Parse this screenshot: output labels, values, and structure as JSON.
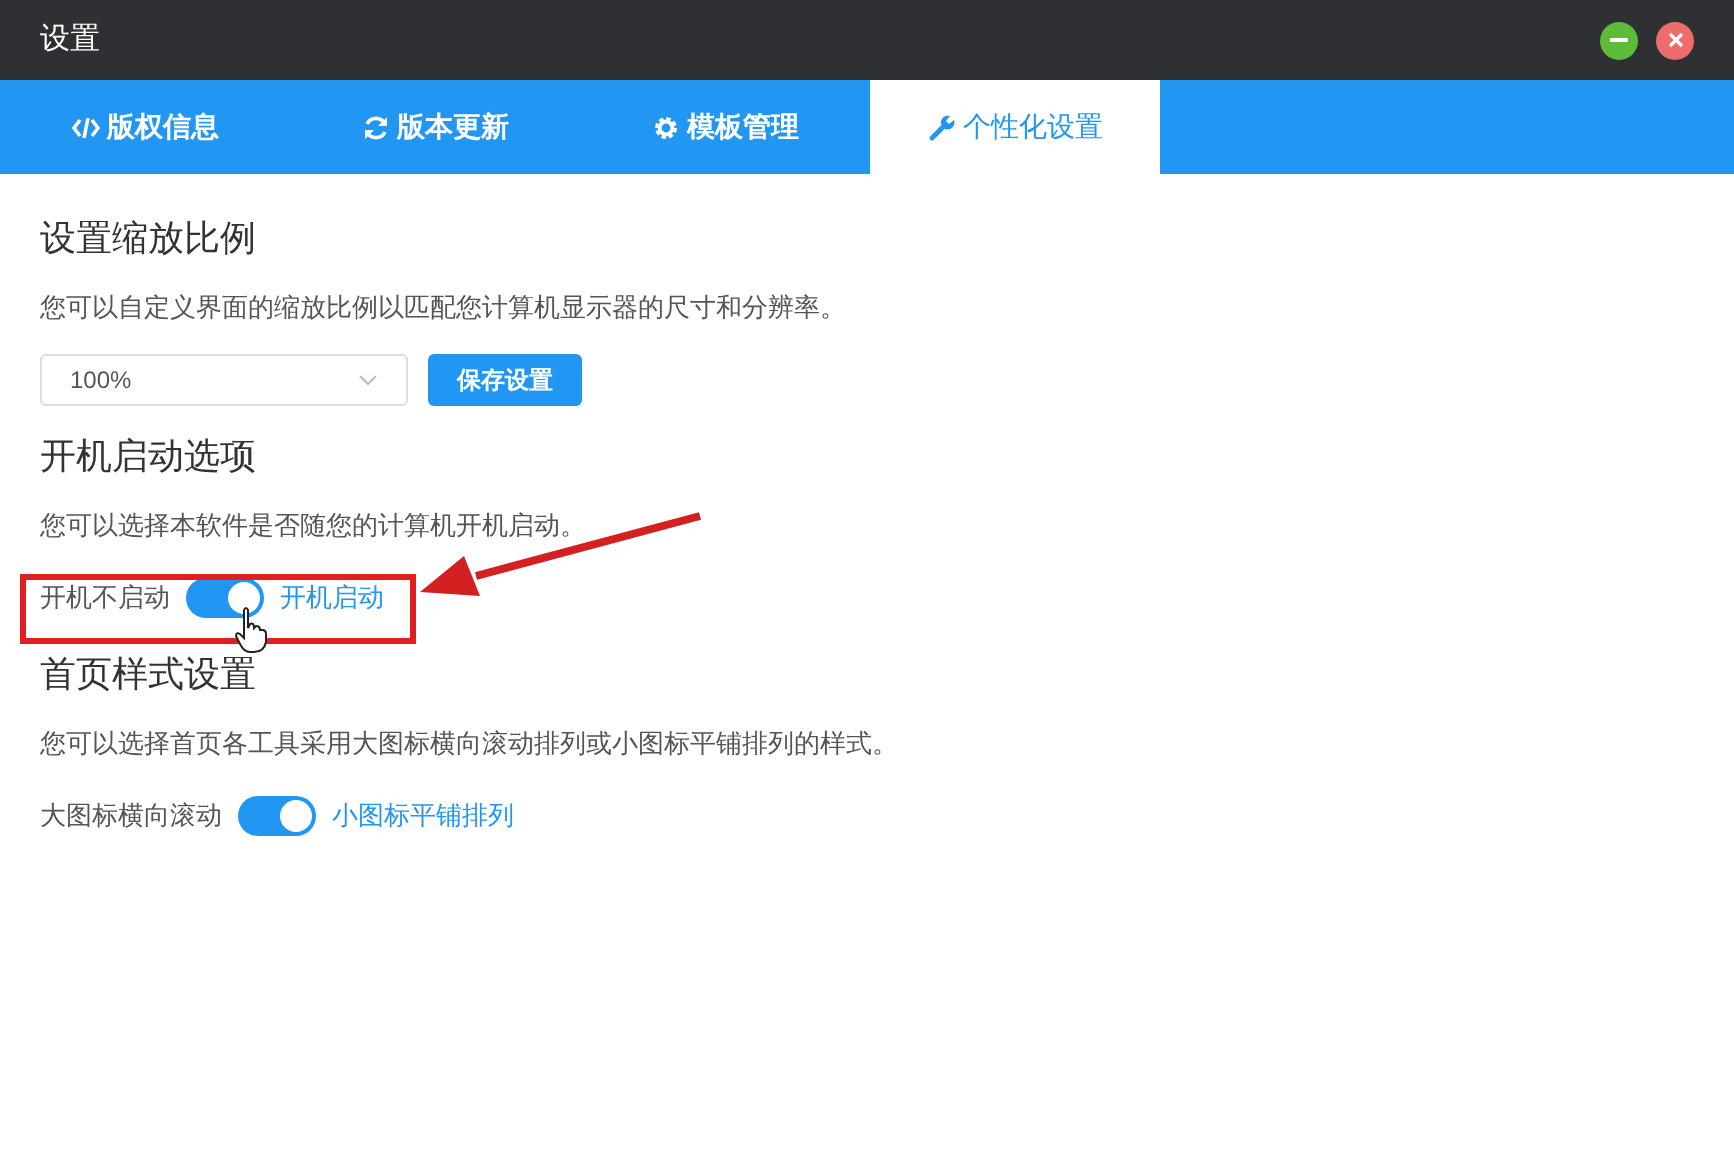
{
  "window": {
    "title": "设置"
  },
  "tabs": [
    {
      "label": "版权信息",
      "selected": false
    },
    {
      "label": "版本更新",
      "selected": false
    },
    {
      "label": "模板管理",
      "selected": false
    },
    {
      "label": "个性化设置",
      "selected": true
    }
  ],
  "sections": [
    {
      "title": "设置缩放比例",
      "description": "您可以自定义界面的缩放比例以匹配您计算机显示器的尺寸和分辨率。",
      "kind": "scale",
      "select_value": "100%",
      "button": "保存设置"
    },
    {
      "title": "开机启动选项",
      "description": "您可以选择本软件是否随您的计算机开机启动。",
      "kind": "toggle",
      "off_label": "开机不启动",
      "on_label": "开机启动",
      "on": true
    },
    {
      "title": "首页样式设置",
      "description": "您可以选择首页各工具采用大图标横向滚动排列或小图标平铺排列的样式。",
      "kind": "toggle",
      "off_label": "大图标横向滚动",
      "on_label": "小图标平铺排列",
      "on": true
    }
  ]
}
